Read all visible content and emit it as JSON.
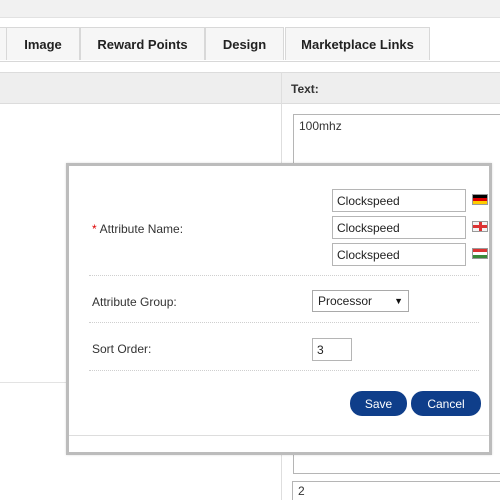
{
  "tabs": [
    {
      "label": "Image"
    },
    {
      "label": "Reward Points"
    },
    {
      "label": "Design"
    },
    {
      "label": "Marketplace Links"
    }
  ],
  "background": {
    "text_column_label": "Text:",
    "textarea_value": "100mhz",
    "bottom_input_value": "2"
  },
  "modal": {
    "attribute_name": {
      "required_marker": "*",
      "label": "Attribute Name:",
      "values": [
        {
          "language": "German",
          "flag_icon": "flag-de-icon",
          "value": "Clockspeed"
        },
        {
          "language": "English",
          "flag_icon": "flag-gb-icon",
          "value": "Clockspeed"
        },
        {
          "language": "Hungarian",
          "flag_icon": "flag-hu-icon",
          "value": "Clockspeed"
        }
      ]
    },
    "attribute_group": {
      "label": "Attribute Group:",
      "selected": "Processor"
    },
    "sort_order": {
      "label": "Sort Order:",
      "value": "3"
    },
    "buttons": {
      "save": "Save",
      "cancel": "Cancel"
    }
  },
  "colors": {
    "button_bg": "#0f3e8a",
    "required": "#dd0000"
  }
}
